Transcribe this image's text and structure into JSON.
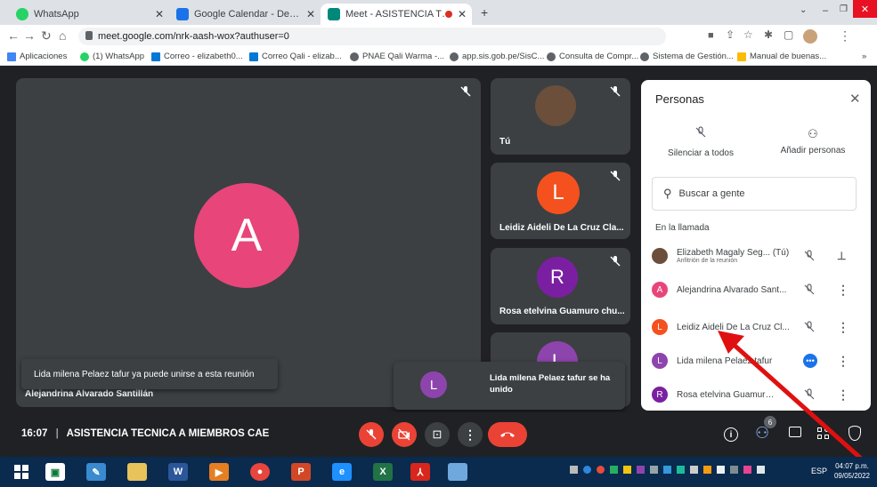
{
  "tabs": [
    {
      "label": "WhatsApp",
      "color": "#25d366"
    },
    {
      "label": "Google Calendar - Detalles del e",
      "color": "#1a73e8"
    },
    {
      "label": "Meet - ASISTENCIA TECNICA",
      "color": "#00897b"
    }
  ],
  "address": {
    "url": "meet.google.com/nrk-aash-wox?authuser=0"
  },
  "bookmarks": [
    {
      "label": "Aplicaciones",
      "color": "#4285f4"
    },
    {
      "label": "(1) WhatsApp",
      "color": "#25d366"
    },
    {
      "label": "Correo - elizabeth0...",
      "color": "#0078d4"
    },
    {
      "label": "Correo Qali - elizab...",
      "color": "#0078d4"
    },
    {
      "label": "PNAE Qali Warma -...",
      "color": "#5f6368"
    },
    {
      "label": "app.sis.gob.pe/SisC...",
      "color": "#5f6368"
    },
    {
      "label": "Consulta de Compr...",
      "color": "#5f6368"
    },
    {
      "label": "Sistema de Gestión...",
      "color": "#5f6368"
    },
    {
      "label": "Manual de buenas...",
      "color": "#5f6368"
    }
  ],
  "bookmarks_more": "»",
  "main_tile": {
    "initial": "A",
    "name": "Alejandrina Alvarado Santillán",
    "color": "#e8457a"
  },
  "side_tiles": [
    {
      "initial": "",
      "name": "Tú",
      "color": "#6b4f3a"
    },
    {
      "initial": "L",
      "name": "Leidiz Aideli De La Cruz Cla...",
      "color": "#f4511e"
    },
    {
      "initial": "R",
      "name": "Rosa etelvina Guamuro chu...",
      "color": "#7b1fa2"
    },
    {
      "initial": "L",
      "name": "",
      "color": "#8e44ad"
    }
  ],
  "toast_left": "Lida milena Pelaez tafur ya puede unirse a esta reunión",
  "toast_right": {
    "initial": "L",
    "text": "Lida milena Pelaez tafur se ha unido",
    "color": "#8e44ad"
  },
  "people": {
    "title": "Personas",
    "mute_all": "Silenciar a todos",
    "add_people": "Añadir personas",
    "search_placeholder": "Buscar a gente",
    "section": "En la llamada",
    "list": [
      {
        "initial": "",
        "name": "Elizabeth Magaly Seg... (Tú)",
        "sub": "Anfitrión de la reunión",
        "color": "#6b4f3a"
      },
      {
        "initial": "A",
        "name": "Alejandrina Alvarado Sant...",
        "sub": "",
        "color": "#e8457a"
      },
      {
        "initial": "L",
        "name": "Leidiz Aideli De La Cruz Cl...",
        "sub": "",
        "color": "#f4511e"
      },
      {
        "initial": "L",
        "name": "Lida milena Pelaez tafur",
        "sub": "",
        "color": "#8e44ad"
      },
      {
        "initial": "R",
        "name": "Rosa etelvina Guamuro c...",
        "sub": "",
        "color": "#7b1fa2"
      }
    ]
  },
  "bottom": {
    "time": "16:07",
    "separator": "|",
    "meeting": "ASISTENCIA TECNICA A MIEMBROS CAE",
    "people_count": "6"
  },
  "taskbar": {
    "lang": "ESP",
    "time": "04:07 p.m.",
    "date": "09/05/2022"
  }
}
